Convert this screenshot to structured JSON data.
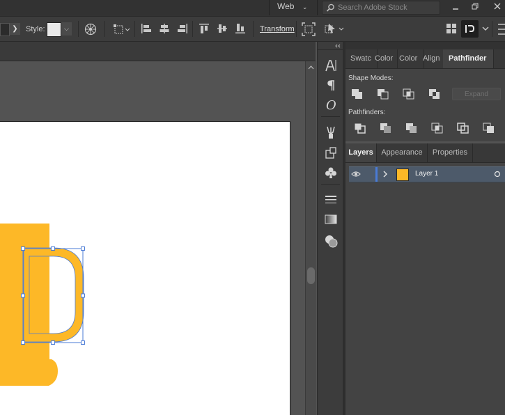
{
  "topbar": {
    "workspace_label": "Web",
    "search_placeholder": "Search Adobe Stock"
  },
  "controlbar": {
    "style_label": "Style:",
    "transform_label": "Transform"
  },
  "pathfinder": {
    "tabs": [
      "Swatc",
      "Color",
      "Color",
      "Align",
      "Pathfinder"
    ],
    "active_tab": "Pathfinder",
    "shape_modes_label": "Shape Modes:",
    "pathfinders_label": "Pathfinders:",
    "expand_label": "Expand"
  },
  "layers": {
    "tabs": [
      "Layers",
      "Appearance",
      "Properties"
    ],
    "active_tab": "Layers",
    "rows": [
      {
        "name": "Layer 1",
        "color": "#4a7bd6"
      }
    ]
  },
  "colors": {
    "shape_fill": "#FDB827",
    "selection": "#4a7bd6",
    "artboard": "#ffffff",
    "panel_bg": "#434343"
  }
}
